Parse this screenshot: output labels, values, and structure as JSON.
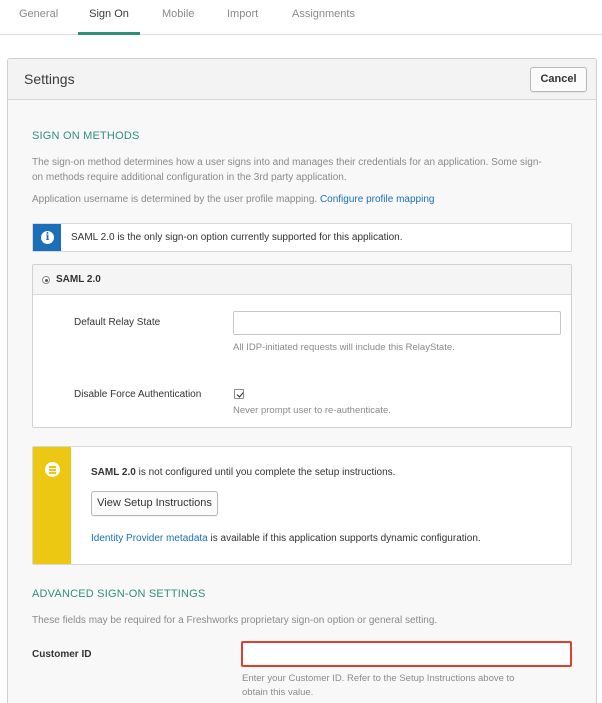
{
  "tabs": [
    {
      "label": "General"
    },
    {
      "label": "Sign On"
    },
    {
      "label": "Mobile"
    },
    {
      "label": "Import"
    },
    {
      "label": "Assignments"
    }
  ],
  "active_tab": "Sign On",
  "panel": {
    "title": "Settings",
    "cancel_label": "Cancel"
  },
  "sign_on_methods": {
    "heading": "SIGN ON METHODS",
    "desc_line1": "The sign-on method determines how a user signs into and manages their credentials for an application. Some sign-",
    "desc_line2": "on methods require additional configuration in the 3rd party application.",
    "username_text": "Application username is determined by the user profile mapping.",
    "configure_link": "Configure profile mapping"
  },
  "info_notice": {
    "icon": "info-icon",
    "text": "SAML 2.0 is the only sign-on option currently supported for this application."
  },
  "saml": {
    "option_label": "SAML 2.0",
    "selected": true,
    "relay_state_label": "Default Relay State",
    "relay_state_value": "",
    "relay_state_hint": "All IDP-initiated requests will include this RelayState.",
    "force_auth_label": "Disable Force Authentication",
    "force_auth_checked": true,
    "force_auth_hint": "Never prompt user to re-authenticate."
  },
  "setup_notice": {
    "icon": "list-icon",
    "bold": "SAML 2.0",
    "text": " is not configured until you complete the setup instructions.",
    "button_label": "View Setup Instructions",
    "meta_link": "Identity Provider metadata",
    "meta_text": " is available if this application supports dynamic configuration."
  },
  "advanced": {
    "heading": "ADVANCED SIGN-ON SETTINGS",
    "desc": "These fields may be required for a Freshworks proprietary sign-on option or general setting.",
    "customer_id_label": "Customer ID",
    "customer_id_value": "",
    "customer_id_hint_line1": "Enter your Customer ID. Refer to the Setup Instructions above to",
    "customer_id_hint_line2": "obtain this value."
  },
  "colors": {
    "accent": "#2f8f7c",
    "link": "#1b6fb8",
    "info": "#1b6fb8",
    "warning": "#ecc812",
    "highlight": "#e0402a"
  }
}
